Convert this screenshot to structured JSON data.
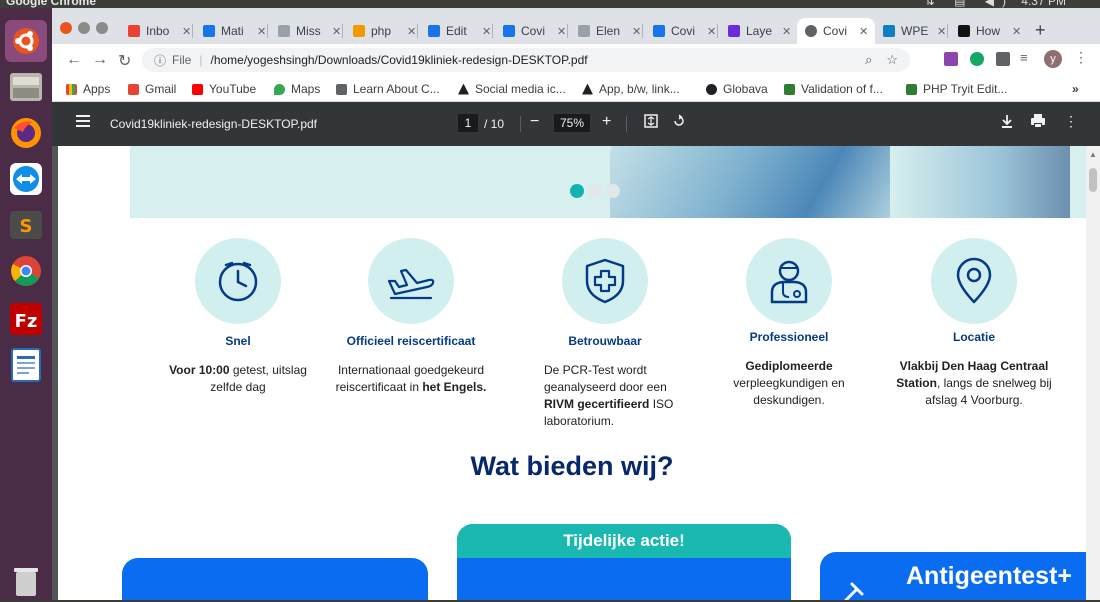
{
  "os": {
    "title": "Google Chrome",
    "time": "4:37 PM"
  },
  "launcher": [
    "ubuntu-icon",
    "files-icon",
    "firefox-icon",
    "teamviewer-icon",
    "sublime-icon",
    "chrome-icon",
    "filezilla-icon",
    "writer-icon",
    "trash-icon"
  ],
  "tabs": [
    {
      "label": "Inbo",
      "color": "#ea4335"
    },
    {
      "label": "Mati",
      "color": "#1a73e8"
    },
    {
      "label": "Miss",
      "color": "#9aa0a6"
    },
    {
      "label": "php",
      "color": "#f29900"
    },
    {
      "label": "Edit",
      "color": "#1a73e8"
    },
    {
      "label": "Covi",
      "color": "#1a73e8"
    },
    {
      "label": "Elen",
      "color": "#9aa0a6"
    },
    {
      "label": "Covi",
      "color": "#1a73e8"
    },
    {
      "label": "Laye",
      "color": "#6c2bd9"
    },
    {
      "label": "Covi",
      "color": "#5f6368",
      "active": true
    },
    {
      "label": "WPE",
      "color": "#0f7fc4"
    },
    {
      "label": "How",
      "color": "#111111"
    }
  ],
  "address": {
    "scheme_label": "File",
    "url": "/home/yogeshsingh/Downloads/Covid19kliniek-redesign-DESKTOP.pdf",
    "avatar_letter": "y"
  },
  "bookmarks": [
    {
      "label": "Apps",
      "color": "#ea4335"
    },
    {
      "label": "Gmail",
      "color": "#ea4335"
    },
    {
      "label": "YouTube",
      "color": "#ff0000"
    },
    {
      "label": "Maps",
      "color": "#34a853"
    },
    {
      "label": "Learn About C...",
      "color": "#5f6368"
    },
    {
      "label": "Social media ic...",
      "color": "#202124"
    },
    {
      "label": "App, b/w, link...",
      "color": "#202124"
    },
    {
      "label": "Globava",
      "color": "#202124"
    },
    {
      "label": "Validation of f...",
      "color": "#2e7d32"
    },
    {
      "label": "PHP Tryit Edit...",
      "color": "#2e7d32"
    }
  ],
  "pdf": {
    "title": "Covid19kliniek-redesign-DESKTOP.pdf",
    "page": "1",
    "total": "/ 10",
    "zoom": "75%"
  },
  "content": {
    "features": [
      {
        "icon": "clock-icon",
        "title": "Snel",
        "desc_bold": "Voor 10:00",
        "desc": " getest, uitslag zelfde dag"
      },
      {
        "icon": "plane-icon",
        "title": "Officieel reiscertificaat",
        "desc": "Internationaal goedgekeurd reiscertificaat in ",
        "desc_bold_end": "het Engels."
      },
      {
        "icon": "shield-icon",
        "title": "Betrouwbaar",
        "desc": "De PCR-Test wordt geanalyseerd door een ",
        "desc_bold_mid": "RIVM gecertifieerd",
        "desc_end": " ISO laboratorium."
      },
      {
        "icon": "nurse-icon",
        "title": "Professioneel",
        "desc_bold": "Gediplomeerde",
        "desc": " verpleegkundigen en deskundigen."
      },
      {
        "icon": "location-icon",
        "title": "Locatie",
        "desc_bold": "Vlakbij Den Haag Centraal Station",
        "desc": ", langs de snelweg bij afslag 4 Voorburg."
      }
    ],
    "section_title": "Wat bieden wij?",
    "promo_label": "Tijdelijke actie!",
    "card3_title": "Antigeentest+"
  },
  "colors": {
    "brand_navy": "#063a86",
    "teal": "#19b8b0",
    "blue": "#0a6cf0",
    "circle_bg": "#d2eff0"
  }
}
